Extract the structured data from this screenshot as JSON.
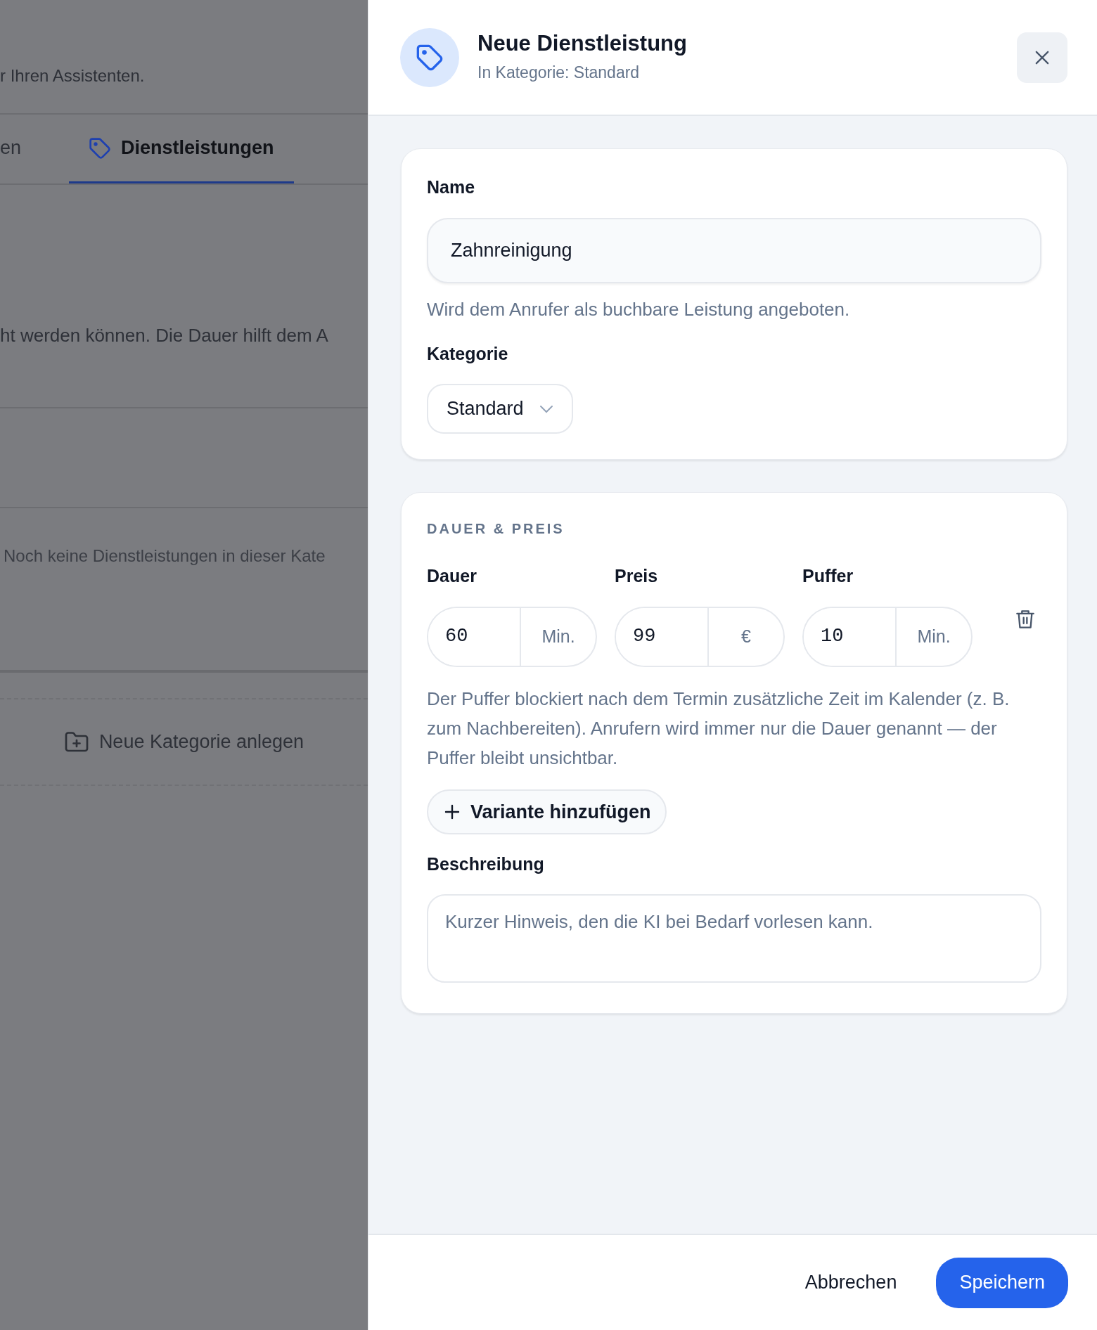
{
  "background": {
    "intro_fragment": "r Ihren Assistenten.",
    "tabs": [
      {
        "label": "en",
        "selected": false
      },
      {
        "label": "Dienstleistungen",
        "selected": true
      }
    ],
    "description_fragment": "ht werden können. Die Dauer hilft dem A",
    "empty_message": "Noch keine Dienstleistungen in dieser Kate",
    "new_category_button": "Neue Kategorie anlegen"
  },
  "drawer": {
    "title": "Neue Dienstleistung",
    "subtitle": "In Kategorie: Standard",
    "name": {
      "label": "Name",
      "value": "Zahnreinigung",
      "help": "Wird dem Anrufer als buchbare Leistung angeboten."
    },
    "category": {
      "label": "Kategorie",
      "value": "Standard"
    },
    "pricing": {
      "heading": "DAUER & PREIS",
      "fields": [
        {
          "label": "Dauer",
          "value": "60",
          "unit": "Min."
        },
        {
          "label": "Preis",
          "value": "99",
          "unit": "€"
        },
        {
          "label": "Puffer",
          "value": "10",
          "unit": "Min."
        }
      ],
      "help": "Der Puffer blockiert nach dem Termin zusätzliche Zeit im Kalender (z. B. zum Nachbereiten). Anrufern wird immer nur die Dauer genannt — der Puffer bleibt unsichtbar.",
      "add_variant": "Variante hinzufügen"
    },
    "description": {
      "label": "Beschreibung",
      "placeholder": "Kurzer Hinweis, den die KI bei Bedarf vorlesen kann."
    },
    "footer": {
      "cancel": "Abbrechen",
      "save": "Speichern"
    }
  }
}
